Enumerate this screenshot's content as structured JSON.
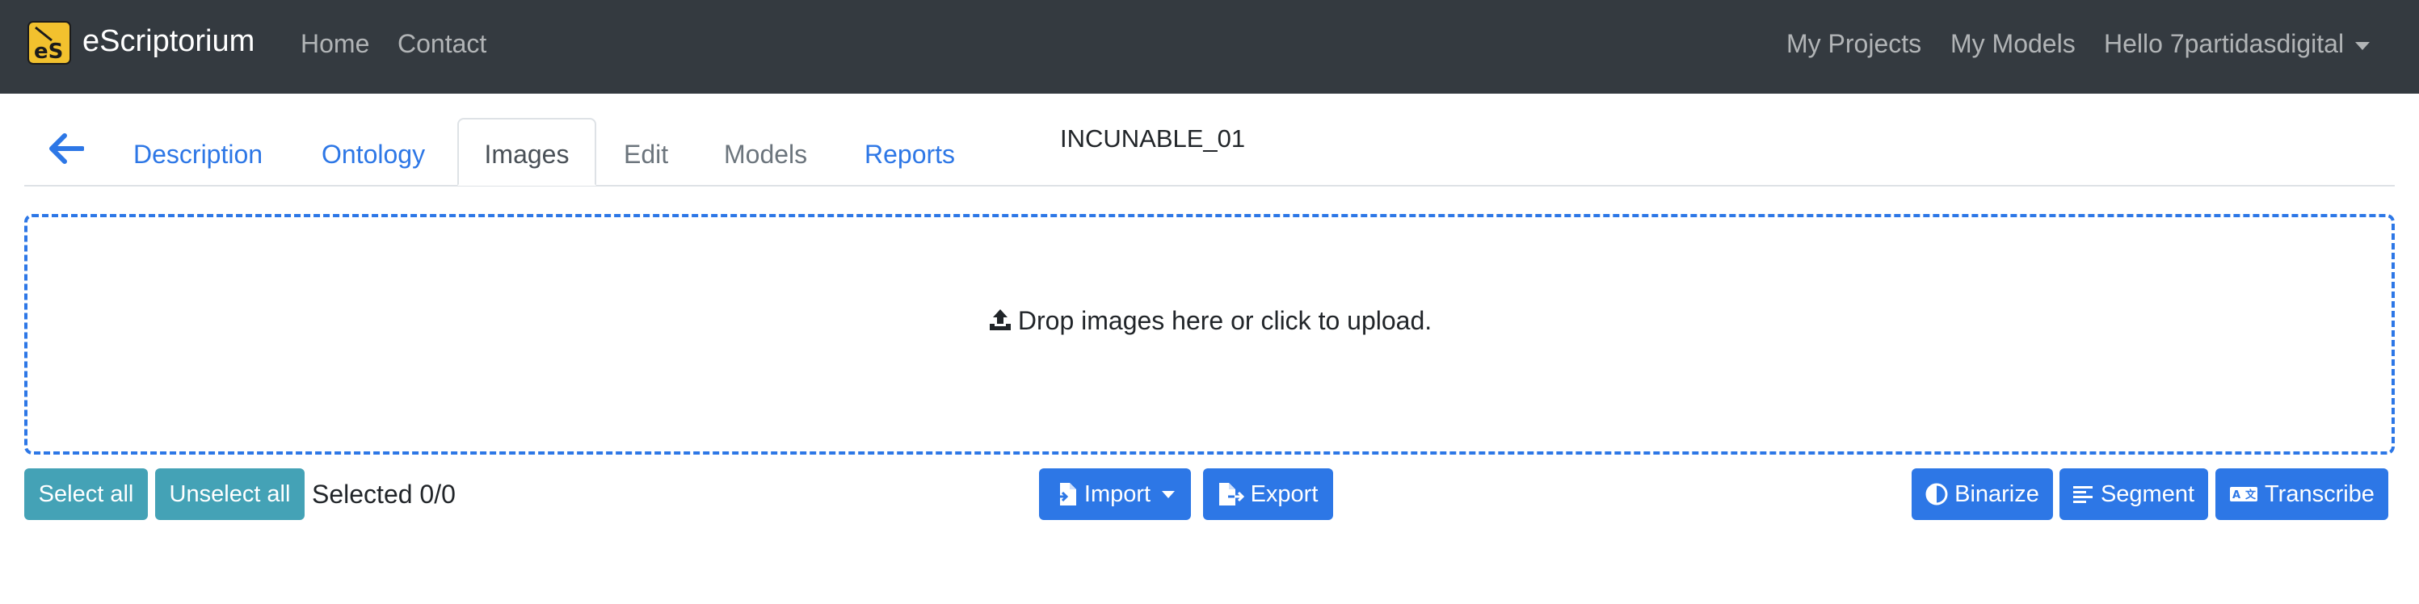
{
  "navbar": {
    "brand": "eScriptorium",
    "logo_text": "eS",
    "links": [
      "Home",
      "Contact"
    ],
    "right_links": [
      "My Projects",
      "My Models"
    ],
    "user_menu": "Hello 7partidasdigital"
  },
  "tabs": {
    "items": [
      "Description",
      "Ontology",
      "Images",
      "Edit",
      "Models",
      "Reports"
    ],
    "active": "Images"
  },
  "document": {
    "title": "INCUNABLE_01"
  },
  "dropzone": {
    "message": "Drop images here or click to upload."
  },
  "actions": {
    "select_all": "Select all",
    "unselect_all": "Unselect all",
    "selected_count": "Selected 0/0",
    "import": "Import",
    "export": "Export",
    "binarize": "Binarize",
    "segment": "Segment",
    "transcribe": "Transcribe"
  },
  "colors": {
    "navbar_bg": "#343a40",
    "link_blue": "#2d77e6",
    "teal": "#44a2b6",
    "logo_yellow": "#f2c12e"
  }
}
